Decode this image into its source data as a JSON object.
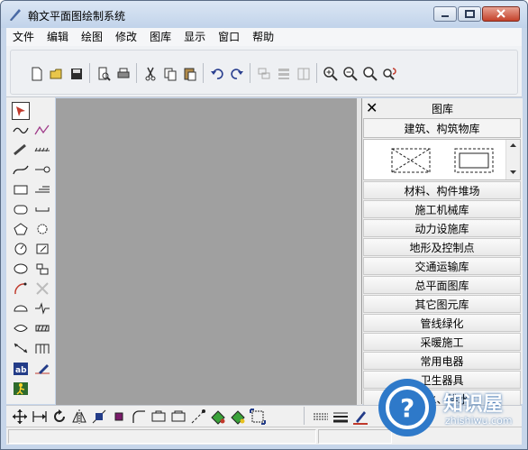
{
  "window": {
    "title": "翰文平面图绘制系统"
  },
  "menubar": {
    "items": [
      "文件",
      "编辑",
      "绘图",
      "修改",
      "图库",
      "显示",
      "窗口",
      "帮助"
    ]
  },
  "toolbar": {
    "icons": [
      "new-file-icon",
      "open-folder-icon",
      "save-icon",
      "print-preview-icon",
      "print-icon",
      "cut-icon",
      "copy-icon",
      "paste-icon",
      "undo-icon",
      "redo-icon",
      "group-icon",
      "align-icon",
      "window-icon",
      "zoom-in-icon",
      "zoom-out-icon",
      "zoom-icon",
      "zoom-refresh-icon"
    ]
  },
  "library": {
    "title": "图库",
    "active_category": "建筑、构筑物库",
    "categories": [
      "材料、构件堆场",
      "施工机械库",
      "动力设施库",
      "地形及控制点",
      "交通运输库",
      "总平面图库",
      "其它图元库",
      "管线绿化",
      "采暖施工",
      "常用电器",
      "卫生器具",
      "给水、排水"
    ]
  },
  "watermark": {
    "brand": "知识屋",
    "url": "zhishiwu.com"
  }
}
